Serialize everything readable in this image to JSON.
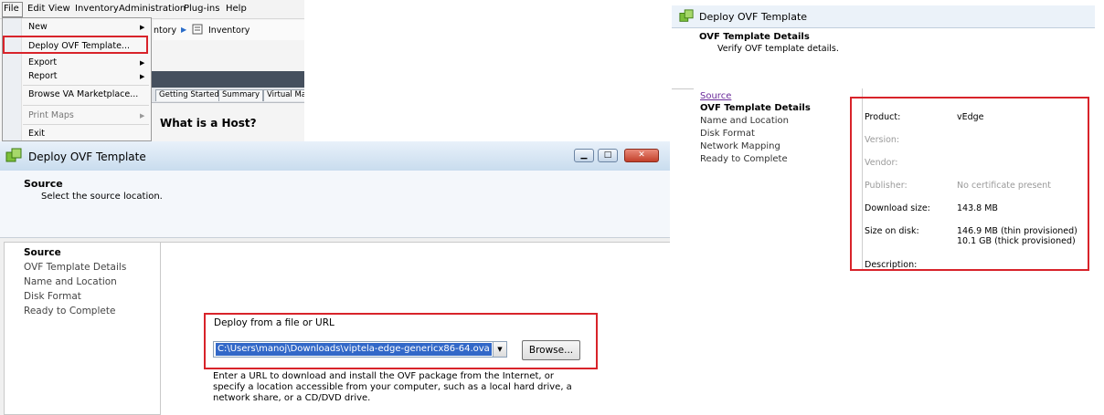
{
  "menu_panel": {
    "menubar": [
      "File",
      "Edit",
      "View",
      "Inventory",
      "Administration",
      "Plug-ins",
      "Help"
    ],
    "file_menu": {
      "new_label": "New",
      "deploy_label": "Deploy OVF Template...",
      "export_label": "Export",
      "report_label": "Report",
      "marketplace_label": "Browse VA Marketplace...",
      "print_maps_label": "Print Maps",
      "exit_label": "Exit"
    },
    "breadcrumb": {
      "partial": "ntory",
      "inventory": "Inventory"
    },
    "tabs": [
      "Getting Started",
      "Summary",
      "Virtual Ma"
    ],
    "host_heading": "What is a Host?"
  },
  "wizard": {
    "title": "Deploy OVF Template",
    "header_title": "Source",
    "header_subtitle": "Select the source location.",
    "steps": [
      "Source",
      "OVF Template Details",
      "Name and Location",
      "Disk Format",
      "Ready to Complete"
    ],
    "field_label": "Deploy from a file or URL",
    "path_value": "C:\\Users\\manoj\\Downloads\\viptela-edge-genericx86-64.ova",
    "browse_label": "Browse...",
    "help_lines": [
      "Enter a URL to download and install the OVF package from the Internet, or",
      "specify a location accessible from your computer, such as a local hard drive, a",
      "network share, or a CD/DVD drive."
    ]
  },
  "details": {
    "title": "Deploy OVF Template",
    "header_title": "OVF Template Details",
    "header_subtitle": "Verify OVF template details.",
    "steps": [
      "Source",
      "OVF Template Details",
      "Name and Location",
      "Disk Format",
      "Network Mapping",
      "Ready to Complete"
    ],
    "props": {
      "product_label": "Product:",
      "product_value": "vEdge",
      "version_label": "Version:",
      "vendor_label": "Vendor:",
      "publisher_label": "Publisher:",
      "publisher_value": "No certificate present",
      "download_label": "Download size:",
      "download_value": "143.8 MB",
      "disk_label": "Size on disk:",
      "disk_value_1": "146.9 MB (thin provisioned)",
      "disk_value_2": "10.1 GB (thick provisioned)",
      "description_label": "Description:"
    }
  },
  "colors": {
    "highlight_box": "#d8232a",
    "selection": "#3268c8",
    "titlebar": "#c9dcee"
  }
}
